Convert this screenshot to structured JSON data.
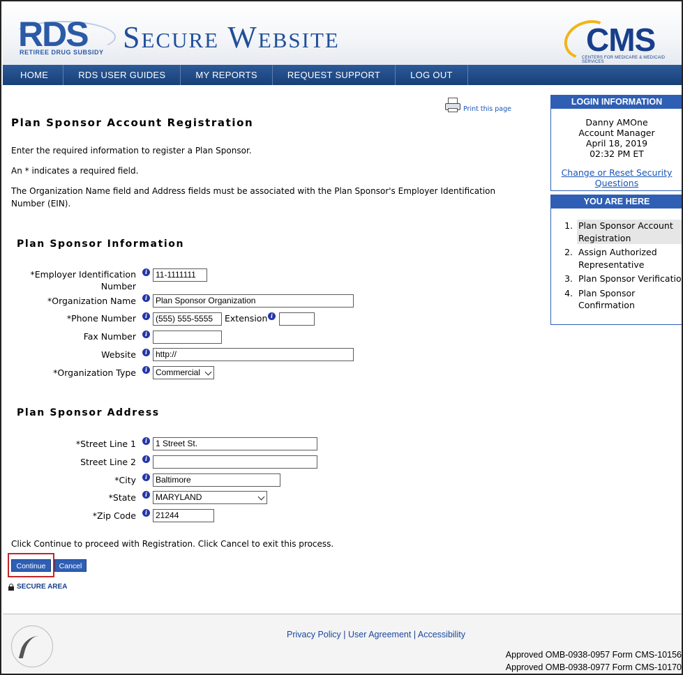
{
  "header": {
    "rds_logo": "RDS",
    "rds_sub": "RETIREE DRUG SUBSIDY",
    "site_title": "Secure Website",
    "cms_logo": "CMS",
    "cms_sub": "CENTERS FOR MEDICARE & MEDICAID SERVICES"
  },
  "nav": {
    "home": "HOME",
    "guides": "RDS USER GUIDES",
    "reports": "MY REPORTS",
    "support": "REQUEST SUPPORT",
    "logout": "LOG OUT"
  },
  "print_label": "Print this page",
  "page_title": "Plan Sponsor Account Registration",
  "intro": {
    "line1": "Enter the required information to register a Plan Sponsor.",
    "line2": "An * indicates a required field.",
    "line3": "The Organization Name field and Address fields must be associated with the Plan Sponsor's Employer Identification Number (EIN)."
  },
  "info_section": {
    "heading": "Plan Sponsor Information",
    "ein_label": "*Employer Identification Number",
    "ein_value": "11-1111111",
    "org_name_label": "*Organization Name",
    "org_name_value": "Plan Sponsor Organization",
    "phone_label": "*Phone Number",
    "phone_value": "(555) 555-5555",
    "extension_label": "Extension",
    "extension_value": "",
    "fax_label": "Fax Number",
    "fax_value": "",
    "website_label": "Website",
    "website_value": "http://",
    "org_type_label": "*Organization Type",
    "org_type_value": "Commercial"
  },
  "address_section": {
    "heading": "Plan Sponsor Address",
    "street1_label": "*Street Line 1",
    "street1_value": "1 Street St.",
    "street2_label": "Street Line 2",
    "street2_value": "",
    "city_label": "*City",
    "city_value": "Baltimore",
    "state_label": "*State",
    "state_value": "MARYLAND",
    "zip_label": "*Zip Code",
    "zip_value": "21244"
  },
  "instructions": "Click Continue to proceed with Registration. Click Cancel to exit this process.",
  "buttons": {
    "continue": "Continue",
    "cancel": "Cancel"
  },
  "secure_area": "SECURE AREA",
  "login": {
    "heading": "LOGIN INFORMATION",
    "name": "Danny AMOne",
    "role": "Account Manager",
    "date": "April 18, 2019",
    "time": "02:32 PM ET",
    "link": "Change or Reset Security Questions"
  },
  "you_are_here": {
    "heading": "YOU ARE HERE",
    "steps": [
      {
        "num": "1.",
        "label": "Plan Sponsor Account Registration"
      },
      {
        "num": "2.",
        "label": "Assign Authorized Representative"
      },
      {
        "num": "3.",
        "label": "Plan Sponsor Verification"
      },
      {
        "num": "4.",
        "label": "Plan Sponsor Confirmation"
      }
    ]
  },
  "footer": {
    "privacy": "Privacy Policy",
    "agreement": "User Agreement",
    "accessibility": "Accessibility",
    "sep": "|",
    "omb1": "Approved OMB-0938-0957 Form CMS-10156",
    "omb2": "Approved OMB-0938-0977 Form CMS-10170"
  },
  "colors": {
    "nav_blue": "#2c5998",
    "panel_blue": "#2f5fb4",
    "link_blue": "#1a55b8",
    "highlight_red": "#c1262b"
  }
}
